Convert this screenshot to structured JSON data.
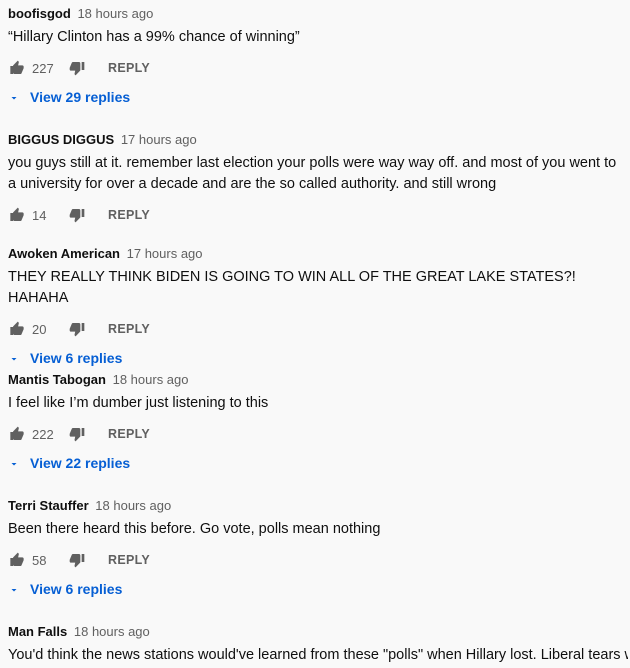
{
  "comments": [
    {
      "author": "boofisgod",
      "time": "18 hours ago",
      "text": "“Hillary Clinton has a 99% chance of winning”",
      "likes": "227",
      "reply_label": "REPLY",
      "view_replies": "View 29 replies"
    },
    {
      "author": "BIGGUS DIGGUS",
      "time": "17 hours ago",
      "text": "you guys still at it. remember last election your polls were way way off.  and most of you went to a university for over a decade and are the so called authority. and still wrong",
      "likes": "14",
      "reply_label": "REPLY",
      "view_replies": ""
    },
    {
      "author": "Awoken American",
      "time": "17 hours ago",
      "text": "THEY REALLY THINK BIDEN IS GOING TO WIN ALL OF THE GREAT LAKE STATES?! HAHAHA",
      "likes": "20",
      "reply_label": "REPLY",
      "view_replies": "View 6 replies"
    },
    {
      "author": "Mantis Tabogan",
      "time": "18 hours ago",
      "text": "I feel like I’m dumber just listening to this",
      "likes": "222",
      "reply_label": "REPLY",
      "view_replies": "View 22 replies"
    },
    {
      "author": "Terri Stauffer",
      "time": "18 hours ago",
      "text": "Been there heard this before.  Go vote, polls mean nothing",
      "likes": "58",
      "reply_label": "REPLY",
      "view_replies": "View 6 replies"
    },
    {
      "author": "Man Falls",
      "time": "18 hours ago",
      "text": "You'd think the news stations would've learned from these \"polls\" when Hillary lost. Liberal tears will",
      "likes": "",
      "reply_label": "",
      "view_replies": ""
    }
  ],
  "icons": {
    "like": "thumbs-up-icon",
    "dislike": "thumbs-down-icon",
    "expand": "chevron-down-icon"
  },
  "colors": {
    "background": "#f9f9f9",
    "link": "#065fd4",
    "secondary_text": "#606060"
  }
}
